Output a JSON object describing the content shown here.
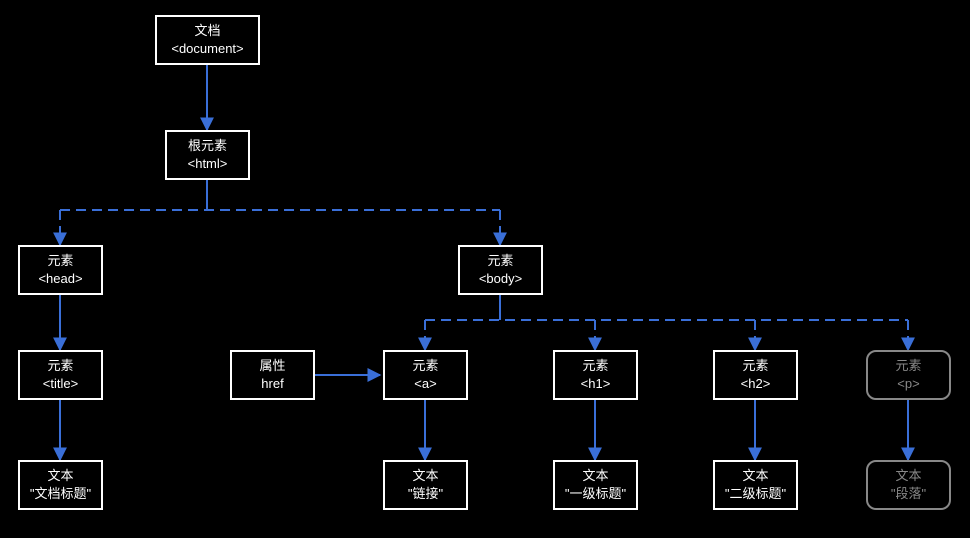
{
  "nodes": {
    "document": {
      "label": "文档",
      "tag": "<document>"
    },
    "html": {
      "label": "根元素",
      "tag": "<html>"
    },
    "head": {
      "label": "元素",
      "tag": "<head>"
    },
    "body": {
      "label": "元素",
      "tag": "<body>"
    },
    "titleEl": {
      "label": "元素",
      "tag": "<title>"
    },
    "href": {
      "label": "属性",
      "tag": "href"
    },
    "a": {
      "label": "元素",
      "tag": "<a>"
    },
    "h1": {
      "label": "元素",
      "tag": "<h1>"
    },
    "h2": {
      "label": "元素",
      "tag": "<h2>"
    },
    "p": {
      "label": "元素",
      "tag": "<p>"
    },
    "titleText": {
      "label": "文本",
      "tag": "\"文档标题\""
    },
    "aText": {
      "label": "文本",
      "tag": "\"链接\""
    },
    "h1Text": {
      "label": "文本",
      "tag": "\"一级标题\""
    },
    "h2Text": {
      "label": "文本",
      "tag": "\"二级标题\""
    },
    "pText": {
      "label": "文本",
      "tag": "\"段落\""
    }
  }
}
